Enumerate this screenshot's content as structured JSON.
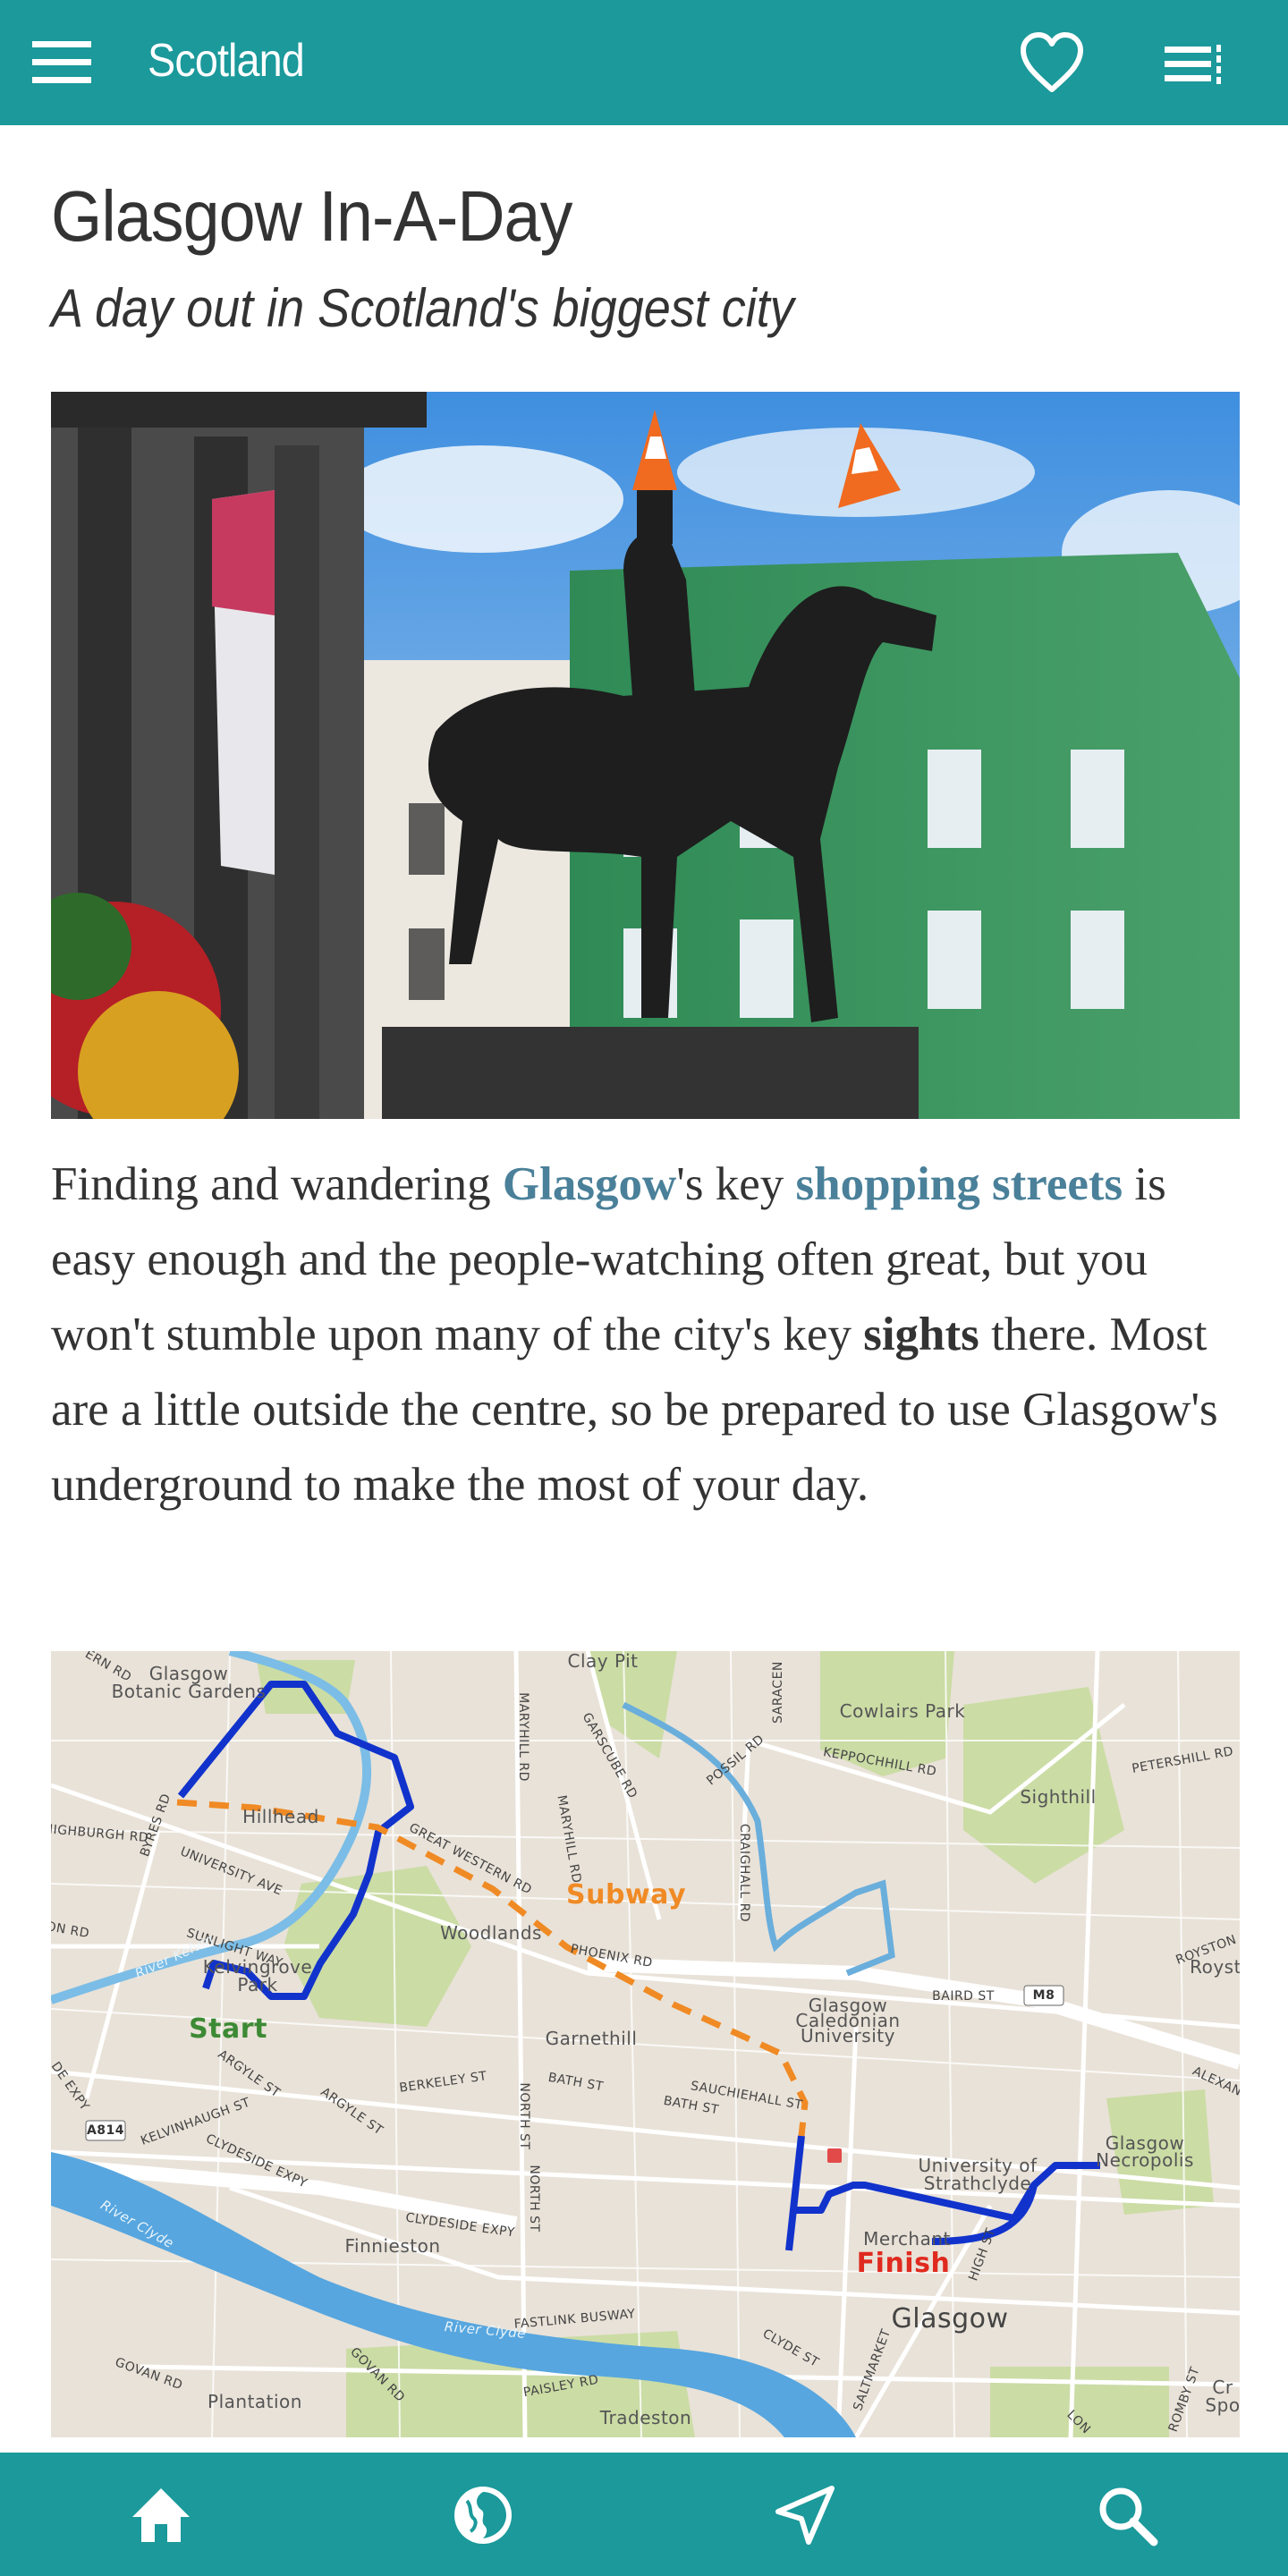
{
  "header": {
    "title": "Scotland",
    "menu_icon": "hamburger-icon",
    "favorite_icon": "heart-icon",
    "toc_icon": "list-icon"
  },
  "colors": {
    "brand": "#1b999b",
    "link": "#4a8099",
    "route": "#1133cc",
    "subway": "#f08a24",
    "start": "#3d8a35",
    "finish": "#e02a1f"
  },
  "article": {
    "title": "Glasgow In-A-Day",
    "subtitle": "A day out in Scotland's biggest city",
    "photo_alt": "Duke of Wellington statue with traffic cones, Glasgow",
    "intro": {
      "t1": "Finding and wandering ",
      "link1": "Glasgow",
      "t2": "'s key ",
      "link2": "shopping streets",
      "t3": " is easy enough and the people-watching often great, but you won't stumble upon many of the city's key ",
      "bold1": "sights",
      "t4": " there. Most are a little outside the centre, so be prepared to use Glasgow's underground to make the most of your day."
    }
  },
  "map": {
    "labels": [
      "Glasgow",
      "Botanic Gardens",
      "ERN RD",
      "Clay Pit",
      "Hillhead",
      "HIGHBURGH RD",
      "BYRES RD",
      "UNIVERSITY AVE",
      "GREAT WESTERN RD",
      "MARYHILL RD",
      "MARYHILL RD",
      "GARSCUBE RD",
      "Subway",
      "Woodlands",
      "SUNLIGHT WAY",
      "River Kelvin",
      "Kelvingrove",
      "Park",
      "Start",
      "ON RD",
      "PHOENIX RD",
      "Garnethill",
      "POSSIL RD",
      "SARACEN",
      "Cowlairs Park",
      "KEPPOCHHILL RD",
      "CRAIGHALL RD",
      "Sighthill",
      "PETERSHILL RD",
      "ROYSTON",
      "Royst",
      "BAIRD ST",
      "M8",
      "Glasgow",
      "Caledonian",
      "University",
      "ALEXAN",
      "DE EXPY",
      "A814",
      "KELVINHAUGH ST",
      "ARGYLE ST",
      "ARGYLE ST",
      "BERKELEY ST",
      "NORTH ST",
      "NORTH ST",
      "BATH ST",
      "BATH ST",
      "SAUCHIEHALL ST",
      "CLYDESIDE EXPY",
      "CLYDESIDE EXPY",
      "Finnieston",
      "University of",
      "Strathclyde",
      "Glasgow",
      "Necropolis",
      "Merchant",
      "Finish",
      "HIGH ST",
      "Glasgow",
      "River Clyde",
      "River Clyde",
      "FASTLINK BUSWAY",
      "CLYDE ST",
      "GOVAN RD",
      "GOVAN RD",
      "Plantation",
      "PAISLEY RD",
      "Tradeston",
      "SALTMARKET",
      "LON",
      "ROMBY ST",
      "Cr",
      "Spo"
    ]
  },
  "bottom_nav": [
    {
      "label": "Home",
      "icon": "home-icon"
    },
    {
      "label": "World",
      "icon": "globe-icon"
    },
    {
      "label": "Nearby",
      "icon": "navigation-icon"
    },
    {
      "label": "Search",
      "icon": "search-icon"
    }
  ]
}
